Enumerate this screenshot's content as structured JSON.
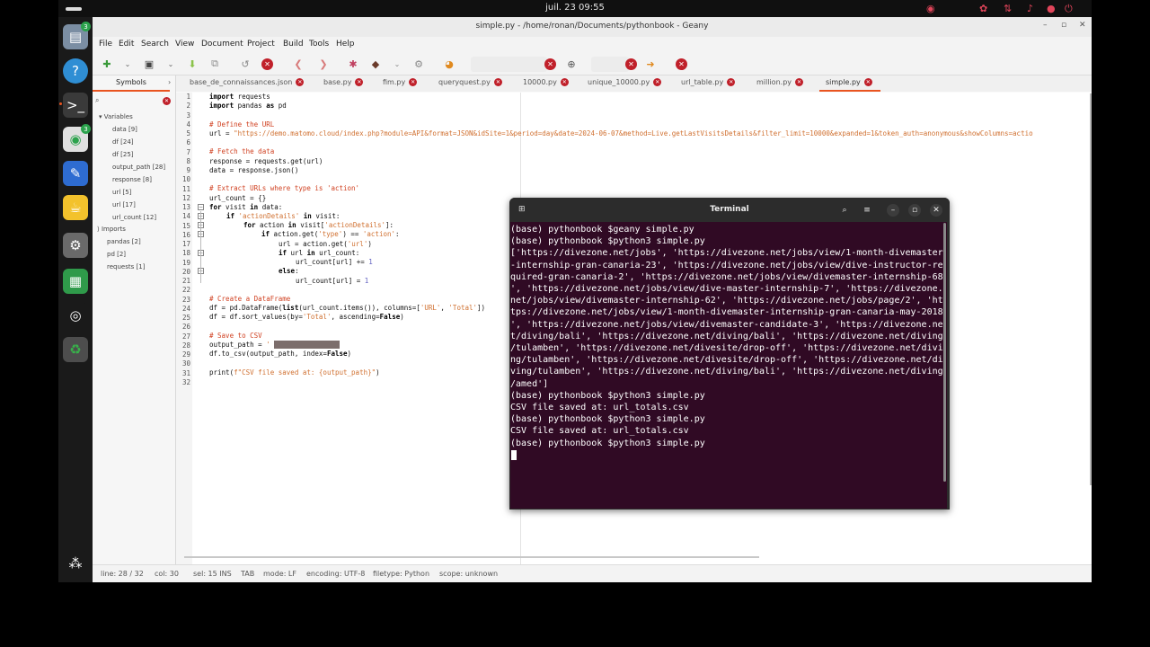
{
  "topbar": {
    "clock": "juil. 23  09:55"
  },
  "dock": {
    "badge_1": "3",
    "badge_2": "3"
  },
  "window": {
    "title": "simple.py - /home/ronan/Documents/pythonbook - Geany"
  },
  "menu": [
    "File",
    "Edit",
    "Search",
    "View",
    "Document",
    "Project",
    "Build",
    "Tools",
    "Help"
  ],
  "sidebar": {
    "tab_label": "Symbols",
    "variables_label": "Variables",
    "variables": [
      "data [9]",
      "df [24]",
      "df [25]",
      "output_path [28]",
      "response [8]",
      "url [5]",
      "url [17]",
      "url_count [12]"
    ],
    "imports_label": "Imports",
    "imports": [
      "pandas [2]",
      "pd [2]",
      "requests [1]"
    ]
  },
  "tabs": [
    "base_de_connaissances.json",
    "base.py",
    "fim.py",
    "queryquest.py",
    "10000.py",
    "unique_10000.py",
    "url_table.py",
    "million.py",
    "simple.py"
  ],
  "editor": {
    "line_numbers": [
      "1",
      "2",
      "3",
      "4",
      "5",
      "6",
      "7",
      "8",
      "9",
      "10",
      "11",
      "12",
      "13",
      "14",
      "15",
      "16",
      "17",
      "18",
      "19",
      "20",
      "21",
      "22",
      "23",
      "24",
      "25",
      "26",
      "27",
      "28",
      "29",
      "30",
      "31",
      "32"
    ],
    "lines": {
      "l1_kw": "import",
      "l1_rest": " requests",
      "l2_kw": "import",
      "l2_mid": " pandas ",
      "l2_kw2": "as",
      "l2_rest": " pd",
      "l4": "# Define the URL",
      "l5_a": "url = ",
      "l5_b": "\"https://demo.matomo.cloud/index.php?module=API&format=JSON&idSite=1&period=day&date=2024-06-07&method=Live.getLastVisitsDetails&filter_limit=10000&expanded=1&token_auth=anonymous&showColumns=actio",
      "l7": "# Fetch the data",
      "l8": "response = requests.get(url)",
      "l9": "data = response.json()",
      "l11": "# Extract URLs where type is 'action'",
      "l12": "url_count = {}",
      "l13_kw": "for",
      "l13_a": " visit ",
      "l13_kw2": "in",
      "l13_b": " data:",
      "l14_kw": "if",
      "l14_s": " 'actionDetails'",
      "l14_kw2": " in",
      "l14_b": " visit:",
      "l15_kw": "for",
      "l15_a": " action ",
      "l15_kw2": "in",
      "l15_b": " visit[",
      "l15_s": "'actionDetails'",
      "l15_c": "]:",
      "l16_kw": "if",
      "l16_a": " action.get(",
      "l16_s": "'type'",
      "l16_b": ") == ",
      "l16_s2": "'action'",
      "l16_c": ":",
      "l17_a": "url = action.get(",
      "l17_s": "'url'",
      "l17_b": ")",
      "l18_kw": "if",
      "l18_a": " url ",
      "l18_kw2": "in",
      "l18_b": " url_count:",
      "l19_a": "url_count[url] += ",
      "l19_n": "1",
      "l20_kw": "else",
      "l21_a": "url_count[url] = ",
      "l21_n": "1",
      "l23": "# Create a DataFrame",
      "l24_a": "df = pd.DataFrame(",
      "l24_kw": "list",
      "l24_b": "(url_count.items()), columns=[",
      "l24_s": "'URL'",
      "l24_c": ", ",
      "l24_s2": "'Total'",
      "l24_d": "])",
      "l25_a": "df = df.sort_values(by=",
      "l25_s": "'Total'",
      "l25_b": ", ascending=",
      "l25_kw": "False",
      "l25_c": ")",
      "l27": "# Save to CSV",
      "l28_a": "output_path = ",
      "l28_s": "'",
      "l29_a": "df.to_csv(output_path, index=",
      "l29_kw": "False",
      "l29_b": ")",
      "l31_a": "print(",
      "l31_s": "f\"CSV file saved at: {output_path}\"",
      "l31_b": ")"
    }
  },
  "status": {
    "line": "line: 28 / 32",
    "col": "col: 30",
    "sel": "sel: 15  INS",
    "tab": "TAB",
    "mode": "mode: LF",
    "encoding": "encoding: UTF-8",
    "filetype": "filetype: Python",
    "scope": "scope: unknown"
  },
  "terminal": {
    "title": "Terminal",
    "lines": [
      "(base) pythonbook $geany simple.py",
      "(base) pythonbook $python3 simple.py",
      "['https://divezone.net/jobs', 'https://divezone.net/jobs/view/1-month-divemaster",
      "-internship-gran-canaria-23', 'https://divezone.net/jobs/view/dive-instructor-re",
      "quired-gran-canaria-2', 'https://divezone.net/jobs/view/divemaster-internship-68",
      "', 'https://divezone.net/jobs/view/dive-master-internship-7', 'https://divezone.",
      "net/jobs/view/divemaster-internship-62', 'https://divezone.net/jobs/page/2', 'ht",
      "tps://divezone.net/jobs/view/1-month-divemaster-internship-gran-canaria-may-2018",
      "', 'https://divezone.net/jobs/view/divemaster-candidate-3', 'https://divezone.ne",
      "t/diving/bali', 'https://divezone.net/diving/bali', 'https://divezone.net/diving",
      "/tulamben', 'https://divezone.net/divesite/drop-off', 'https://divezone.net/divi",
      "ng/tulamben', 'https://divezone.net/divesite/drop-off', 'https://divezone.net/di",
      "ving/tulamben', 'https://divezone.net/diving/bali', 'https://divezone.net/diving",
      "/amed']",
      "(base) pythonbook $python3 simple.py",
      "CSV file saved at: url_totals.csv",
      "(base) pythonbook $python3 simple.py",
      "CSV file saved at: url_totals.csv",
      "(base) pythonbook $python3 simple.py"
    ]
  }
}
